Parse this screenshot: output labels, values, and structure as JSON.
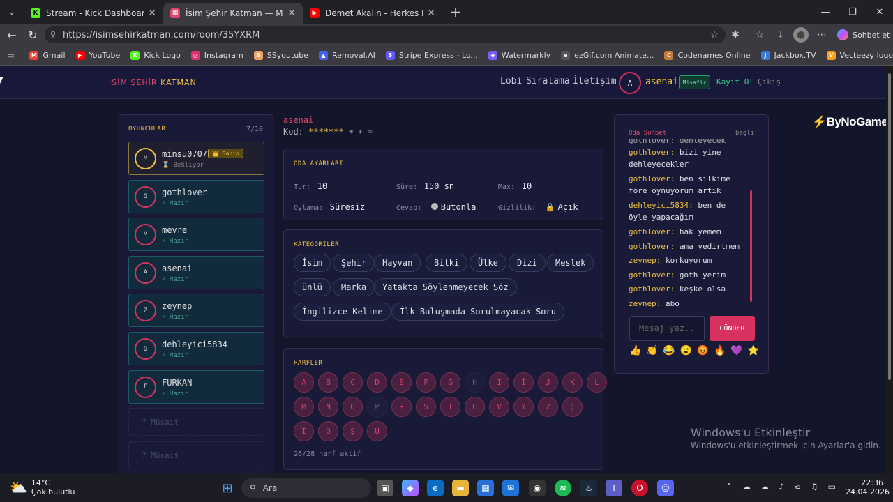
{
  "browser": {
    "tabs": [
      {
        "title": "Stream - Kick Dashboard",
        "fav": "K",
        "color": "#53fc18"
      },
      {
        "title": "İsim Şehir Katman — Multiplayer İ",
        "fav": "▦",
        "color": "#e0456b"
      },
      {
        "title": "Demet Akalın - Herkes Hak Ettiği G",
        "fav": "▶",
        "color": "#ff0000"
      }
    ],
    "url": "https://isimsehirkatman.com/room/35YXRM",
    "copilot": "Sohbet et",
    "bookmarks": [
      {
        "label": "Gmail",
        "color": "#ea4335",
        "icon": "M"
      },
      {
        "label": "YouTube",
        "color": "#ff0000",
        "icon": "▶"
      },
      {
        "label": "Kick Logo",
        "color": "#53fc18",
        "icon": "K"
      },
      {
        "label": "Instagram",
        "color": "#e1306c",
        "icon": "◎"
      },
      {
        "label": "SSyoutube",
        "color": "#f4a261",
        "icon": "S"
      },
      {
        "label": "Removal.AI",
        "color": "#4361ee",
        "icon": "▲"
      },
      {
        "label": "Stripe Express - Lo...",
        "color": "#635bff",
        "icon": "S"
      },
      {
        "label": "Watermarkly",
        "color": "#7b5cff",
        "icon": "◆"
      },
      {
        "label": "ezGif.com Animate...",
        "color": "#555",
        "icon": "e"
      },
      {
        "label": "Codenames Online",
        "color": "#c77d3a",
        "icon": "C"
      },
      {
        "label": "Jackbox.TV",
        "color": "#3a7bd5",
        "icon": "J"
      },
      {
        "label": "Vecteezy logo Vect...",
        "color": "#ff9f1c",
        "icon": "V"
      }
    ]
  },
  "site": {
    "logo1": "İSİM ŞEHİR",
    "logo2": "KATMAN",
    "nav": [
      "Lobi",
      "Sıralama",
      "İletişim"
    ],
    "avatar": "A",
    "username": "asenai",
    "guest": "Misafir",
    "register": "Kayıt Ol",
    "logout": "Çıkış"
  },
  "players": {
    "title": "OYUNCULAR",
    "count": "7/10",
    "list": [
      {
        "initial": "M",
        "name": "minsu0707",
        "status": "⌛ Bekliyor",
        "owner": "👑 Sahip"
      },
      {
        "initial": "G",
        "name": "gothlover",
        "status": "✓ Hazır"
      },
      {
        "initial": "M",
        "name": "mevre",
        "status": "✓ Hazır"
      },
      {
        "initial": "A",
        "name": "asenai",
        "status": "✓ Hazır"
      },
      {
        "initial": "Z",
        "name": "zeynep",
        "status": "✓ Hazır"
      },
      {
        "initial": "D",
        "name": "dehleyici5834",
        "status": "✓ Hazır"
      },
      {
        "initial": "F",
        "name": "FURKAN",
        "status": "✓ Hazır"
      }
    ],
    "empty": [
      "?   Müsait",
      "?   Müsait"
    ]
  },
  "room": {
    "owner": "asenai",
    "code_label": "Kod:",
    "code": "*******",
    "settings_title": "ODA AYARLARI",
    "settings": {
      "tur_l": "Tur:",
      "tur_v": "10",
      "sure_l": "Süre:",
      "sure_v": "150 sn",
      "max_l": "Max:",
      "max_v": "10",
      "oylama_l": "Oylama:",
      "oylama_v": "Süresiz",
      "cevap_l": "Cevap:",
      "cevap_v": "Butonla",
      "gizlilik_l": "Gizlilik:",
      "gizlilik_v": "Açık"
    },
    "categories_title": "KATEGORİLER",
    "categories": [
      "İsim",
      "Şehir",
      "Hayvan",
      "Bitki",
      "Ülke",
      "Dizi",
      "Meslek",
      "ünlü",
      "Marka",
      "Yatakta Söylenmeyecek Söz",
      "İngilizce Kelime",
      "İlk Buluşmada Sorulmayacak Soru"
    ],
    "letters_title": "HARFLER",
    "letters": [
      [
        "A",
        "B",
        "C",
        "D",
        "E",
        "F",
        "G",
        "H",
        "I",
        "İ",
        "J",
        "K",
        "L"
      ],
      [
        "M",
        "N",
        "O",
        "P",
        "R",
        "S",
        "T",
        "U",
        "V",
        "Y",
        "Z",
        "Ç"
      ],
      [
        "İ",
        "Ö",
        "Ş",
        "Ü"
      ]
    ],
    "letters_off": [
      "H",
      "P"
    ],
    "letters_footer": "26/28 harf aktif"
  },
  "chat": {
    "title": "Oda Sohbet",
    "status": "bağlı",
    "partial": "gothlover: dehleyecek",
    "messages": [
      {
        "user": "gothlover:",
        "text": "bizi yine dehleyecekler"
      },
      {
        "user": "gothlover:",
        "text": "ben silkime före oynuyorum artık"
      },
      {
        "user": "dehleyici5834:",
        "text": "ben de öyle yapacağım"
      },
      {
        "user": "gothlover:",
        "text": "hak yemem"
      },
      {
        "user": "gothlover:",
        "text": "ama yedirtmem"
      },
      {
        "user": "zeynep:",
        "text": "korkuyorum"
      },
      {
        "user": "gothlover:",
        "text": "goth yerim"
      },
      {
        "user": "gothlover:",
        "text": "keşke olsa"
      },
      {
        "user": "zeynep:",
        "text": "abo"
      }
    ],
    "placeholder": "Mesaj yaz..",
    "send": "GÖNDER",
    "emojis": [
      "👍",
      "👏",
      "😂",
      "😮",
      "😡",
      "🔥",
      "💜",
      "⭐"
    ]
  },
  "bynogame": "ByNoGame",
  "activation": {
    "title": "Windows'u Etkinleştir",
    "sub": "Windows'u etkinleştirmek için Ayarlar'a gidin."
  },
  "taskbar": {
    "temp": "14°C",
    "weather": "Çok bulutlu",
    "search": "Ara",
    "time": "22:36",
    "date": "24.04.2026"
  }
}
